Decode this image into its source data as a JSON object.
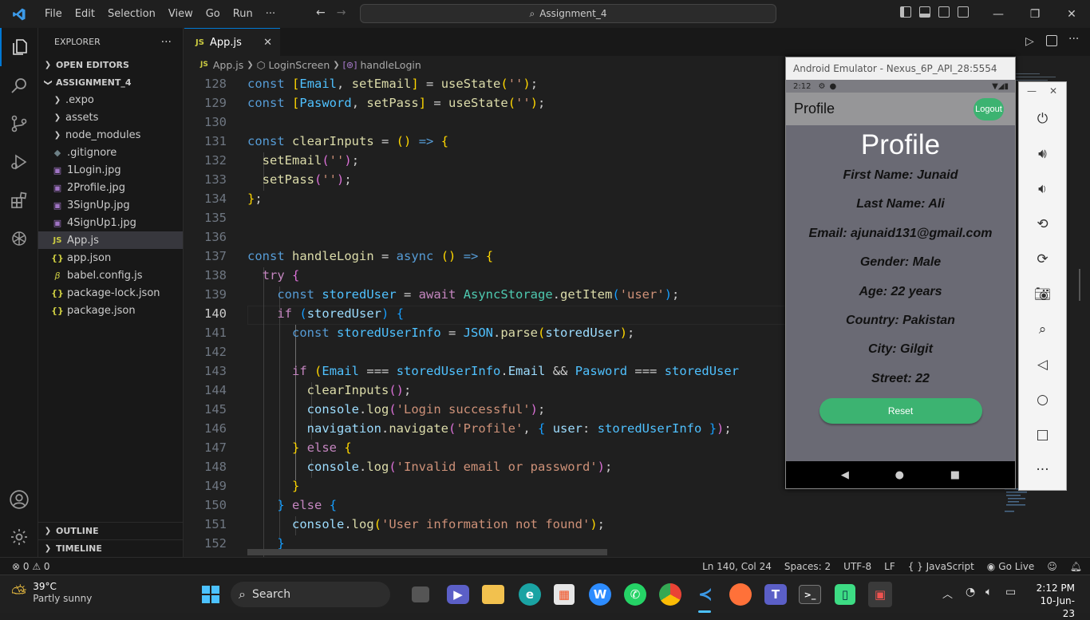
{
  "titlebar": {
    "menu": [
      "File",
      "Edit",
      "Selection",
      "View",
      "Go",
      "Run",
      "···"
    ],
    "search": "Assignment_4"
  },
  "explorer": {
    "title": "EXPLORER",
    "more": "···",
    "open_editors": "OPEN EDITORS",
    "project": "ASSIGNMENT_4",
    "items": [
      {
        "name": ".expo",
        "kind": "folder"
      },
      {
        "name": "assets",
        "kind": "folder"
      },
      {
        "name": "node_modules",
        "kind": "folder"
      },
      {
        "name": ".gitignore",
        "kind": "file"
      },
      {
        "name": "1Login.jpg",
        "kind": "image"
      },
      {
        "name": "2Profile.jpg",
        "kind": "image"
      },
      {
        "name": "3SignUp.jpg",
        "kind": "image"
      },
      {
        "name": "4SignUp1.jpg",
        "kind": "image"
      },
      {
        "name": "App.js",
        "kind": "js"
      },
      {
        "name": "app.json",
        "kind": "json"
      },
      {
        "name": "babel.config.js",
        "kind": "babel"
      },
      {
        "name": "package-lock.json",
        "kind": "json"
      },
      {
        "name": "package.json",
        "kind": "json"
      }
    ],
    "outline": "OUTLINE",
    "timeline": "TIMELINE"
  },
  "tab": {
    "icon": "JS",
    "label": "App.js",
    "close": "✕"
  },
  "breadcrumb": {
    "file": "App.js",
    "component": "LoginScreen",
    "func": "handleLogin"
  },
  "editor": {
    "line_numbers": [
      "128",
      "129",
      "130",
      "131",
      "132",
      "133",
      "134",
      "135",
      "136",
      "137",
      "138",
      "139",
      "140",
      "141",
      "142",
      "143",
      "144",
      "145",
      "146",
      "147",
      "148",
      "149",
      "150",
      "151",
      "152"
    ],
    "current_line": "140"
  },
  "status": {
    "errors": "⊗ 0 ⚠ 0",
    "position": "Ln 140, Col 24",
    "spaces": "Spaces: 2",
    "encoding": "UTF-8",
    "eol": "LF",
    "language": "{ } JavaScript",
    "golive": "Go Live"
  },
  "emulator": {
    "window_title": "Android Emulator - Nexus_6P_API_28:5554",
    "time": "2:12",
    "header_title": "Profile",
    "logout": "Logout",
    "heading": "Profile",
    "fields": [
      "First Name: Junaid",
      "Last Name: Ali",
      "Email: ajunaid131@gmail.com",
      "Gender: Male",
      "Age: 22 years",
      "Country: Pakistan",
      "City: Gilgit",
      "Street: 22"
    ],
    "reset": "Reset"
  },
  "taskbar": {
    "temp": "39°C",
    "weather": "Partly sunny",
    "search": "Search",
    "time": "2:12 PM",
    "date": "10-Jun-23"
  },
  "colors": {
    "accent": "#0078d4",
    "android_green": "#3cb371"
  }
}
